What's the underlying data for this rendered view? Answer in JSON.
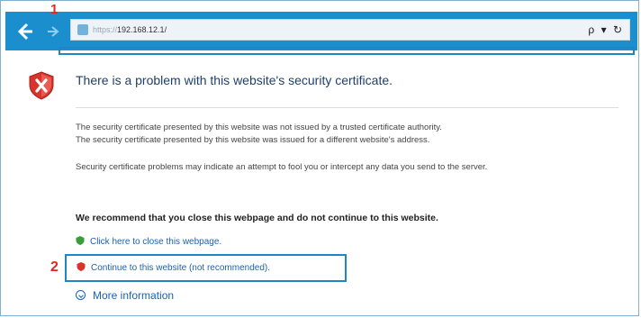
{
  "browser": {
    "url_scheme": "https://",
    "url_host": "192.168.12.1/",
    "addr_tools": "ρ ▾ ↻"
  },
  "steps": {
    "step1": "1",
    "step2": "2"
  },
  "error": {
    "title": "There is a problem with this website's security certificate.",
    "line1": "The security certificate presented by this website was not issued by a trusted certificate authority.",
    "line2": "The security certificate presented by this website was issued for a different website's address.",
    "line3": "Security certificate problems may indicate an attempt to fool you or intercept any data you send to the server.",
    "recommend": "We recommend that you close this webpage and do not continue to this website.",
    "close_link": "Click here to close this webpage.",
    "continue_link": "Continue to this website (not recommended).",
    "more_info": "More information"
  },
  "colors": {
    "toolbar": "#1b8fcd",
    "highlight": "#1f86c6",
    "marker": "#e0281e",
    "link": "#1a62b0",
    "title": "#1f3f6e"
  }
}
